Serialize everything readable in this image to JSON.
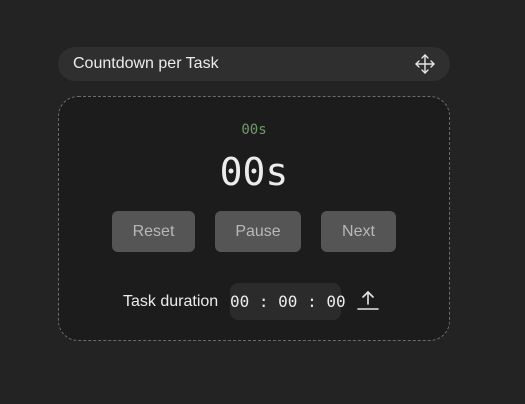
{
  "window": {
    "title": "Countdown per Task",
    "move_icon": "move-arrows-icon"
  },
  "timer": {
    "small_display": "00s",
    "main_display": "00s",
    "small_color": "#6f9a6a"
  },
  "controls": {
    "reset_label": "Reset",
    "pause_label": "Pause",
    "next_label": "Next"
  },
  "duration": {
    "label": "Task duration",
    "value": "00 : 00 : 00",
    "upload_icon": "upload-icon"
  }
}
